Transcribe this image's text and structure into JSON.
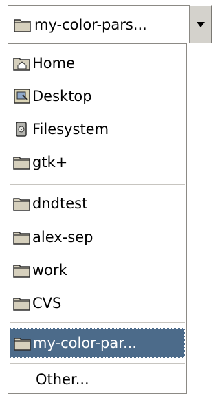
{
  "combo": {
    "selected_label": "my-color-pars...",
    "icon": "folder-icon"
  },
  "menu": {
    "items": [
      {
        "label": "Home",
        "icon": "home-folder-icon"
      },
      {
        "label": "Desktop",
        "icon": "desktop-icon"
      },
      {
        "label": "Filesystem",
        "icon": "filesystem-icon"
      },
      {
        "label": "gtk+",
        "icon": "folder-icon"
      },
      {
        "label": "dndtest",
        "icon": "folder-icon"
      },
      {
        "label": "alex-sep",
        "icon": "folder-icon"
      },
      {
        "label": "work",
        "icon": "folder-icon"
      },
      {
        "label": "CVS",
        "icon": "folder-icon"
      },
      {
        "label": "my-color-par...",
        "icon": "folder-icon",
        "selected": true
      },
      {
        "label": "Other..."
      }
    ]
  },
  "colors": {
    "selection": "#4c6b8a",
    "folder": "#d6d0bd"
  }
}
